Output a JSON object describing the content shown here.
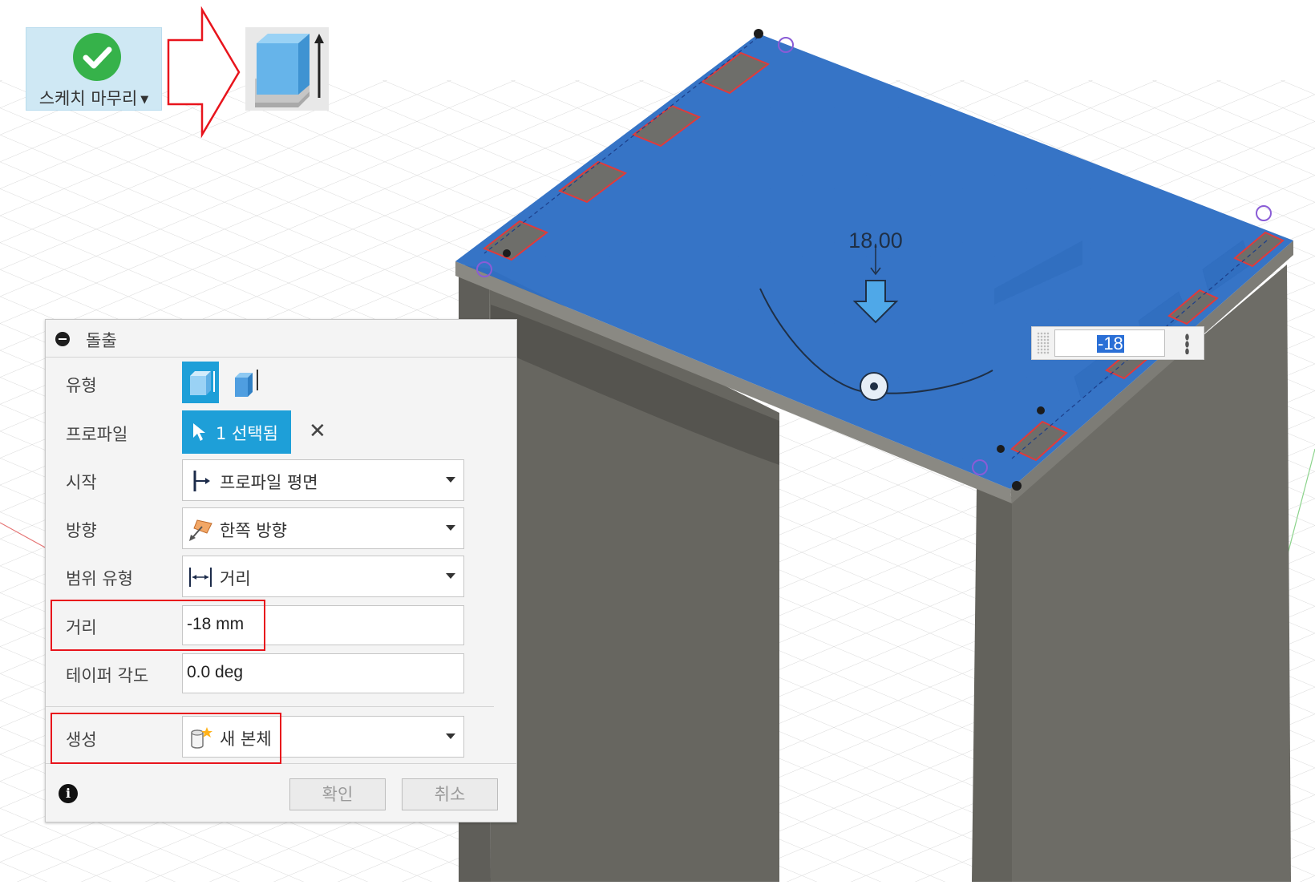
{
  "toolbar": {
    "finish_sketch_label": "스케치 마무리",
    "finish_sketch_icon": "green-check-icon",
    "arrow_icon": "red-outline-arrow-icon",
    "extrude_tool_icon": "extrude-box-icon"
  },
  "viewport": {
    "dimension_label": "18.00",
    "direction_icon": "down-arrow-icon",
    "distance_input_value": "-18",
    "face_color": "#2f6fc4",
    "body_color": "#6b6a64"
  },
  "dialog": {
    "title": "돌출",
    "rows": {
      "type_label": "유형",
      "profile_label": "프로파일",
      "profile_value": "1 선택됨",
      "start_label": "시작",
      "start_value": "프로파일 평면",
      "direction_label": "방향",
      "direction_value": "한쪽 방향",
      "extent_label": "범위 유형",
      "extent_value": "거리",
      "distance_label": "거리",
      "distance_value": "-18 mm",
      "taper_label": "테이퍼 각도",
      "taper_value": "0.0 deg",
      "operation_label": "생성",
      "operation_value": "새 본체"
    },
    "ok_label": "확인",
    "cancel_label": "취소",
    "accent_color": "#1e9fd8",
    "highlight_color": "#e8141c"
  }
}
